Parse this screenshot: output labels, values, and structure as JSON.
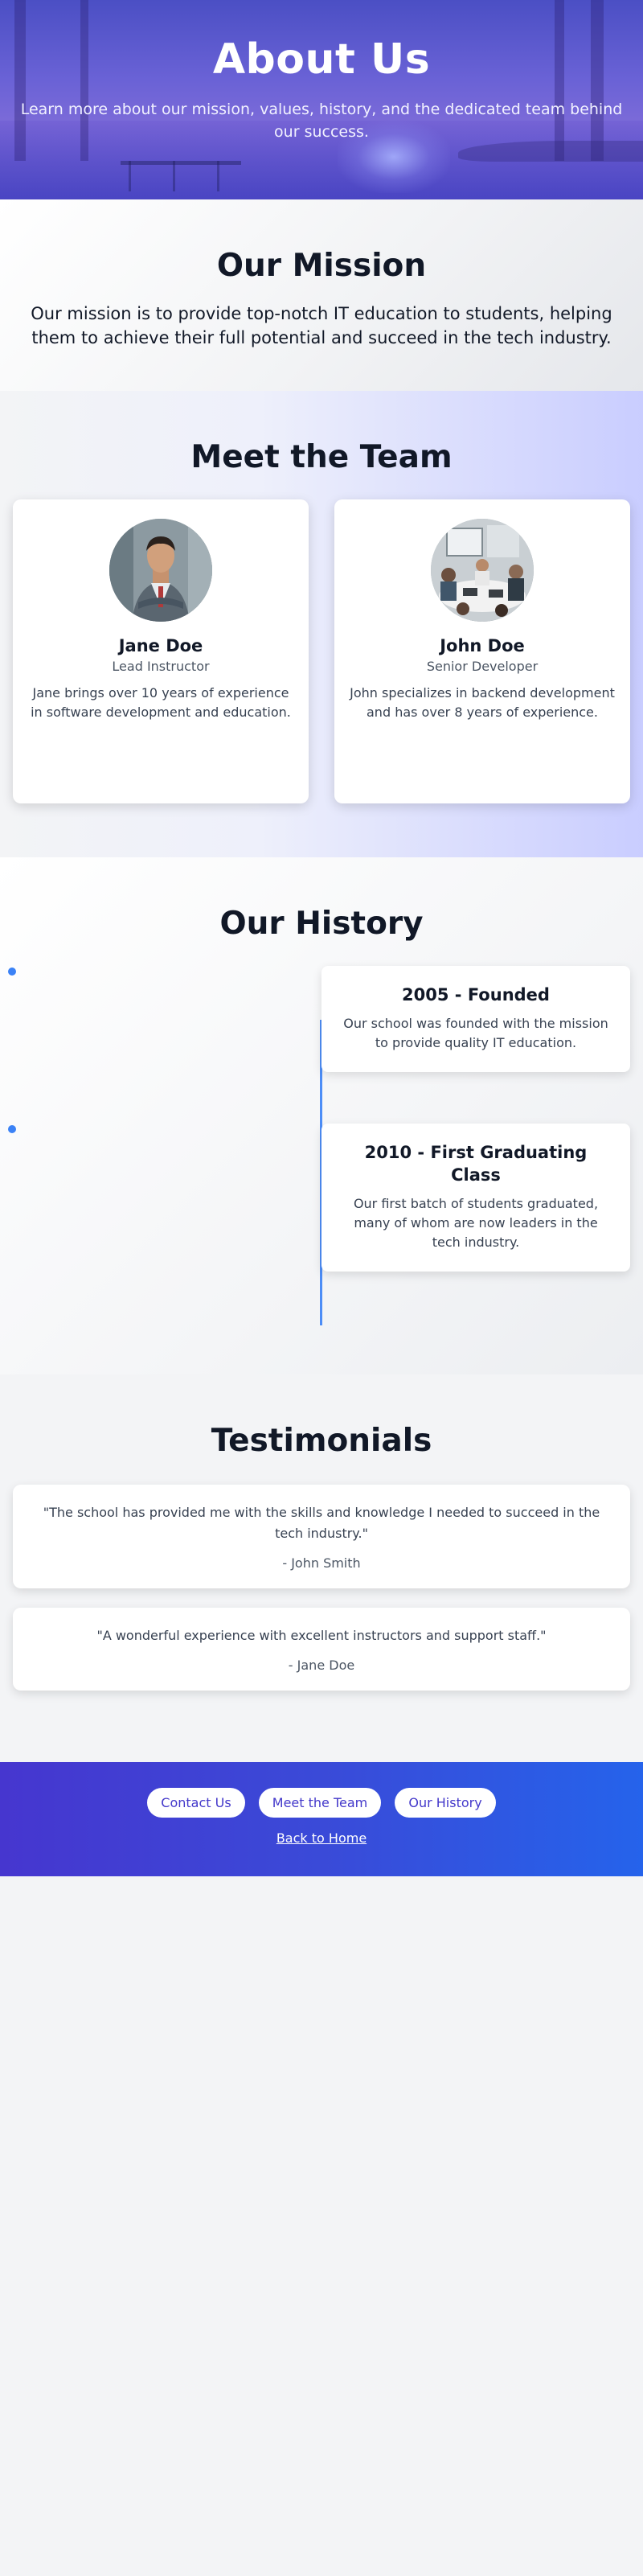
{
  "hero": {
    "title": "About Us",
    "subtitle": "Learn more about our mission, values, history, and the dedicated team behind our success."
  },
  "mission": {
    "title": "Our Mission",
    "text": "Our mission is to provide top-notch IT education to students, helping them to achieve their full potential and succeed in the tech industry."
  },
  "team": {
    "title": "Meet the Team",
    "members": [
      {
        "name": "Jane Doe",
        "role": "Lead Instructor",
        "bio": "Jane brings over 10 years of experience in software development and education."
      },
      {
        "name": "John Doe",
        "role": "Senior Developer",
        "bio": "John specializes in backend development and has over 8 years of experience."
      }
    ]
  },
  "history": {
    "title": "Our History",
    "events": [
      {
        "title": "2005 - Founded",
        "text": "Our school was founded with the mission to provide quality IT education."
      },
      {
        "title": "2010 - First Graduating Class",
        "text": "Our first batch of students graduated, many of whom are now leaders in the tech industry."
      }
    ]
  },
  "testimonials": {
    "title": "Testimonials",
    "items": [
      {
        "quote": "\"The school has provided me with the skills and knowledge I needed to succeed in the tech industry.\"",
        "author": "- John Smith"
      },
      {
        "quote": "\"A wonderful experience with excellent instructors and support staff.\"",
        "author": "- Jane Doe"
      }
    ]
  },
  "footer": {
    "links": [
      "Contact Us",
      "Meet the Team",
      "Our History"
    ],
    "back_home": "Back to Home"
  },
  "colors": {
    "accent": "#3b82f6",
    "footer_start": "#4636cf",
    "footer_end": "#2563eb",
    "pill_text": "#4338ca"
  }
}
